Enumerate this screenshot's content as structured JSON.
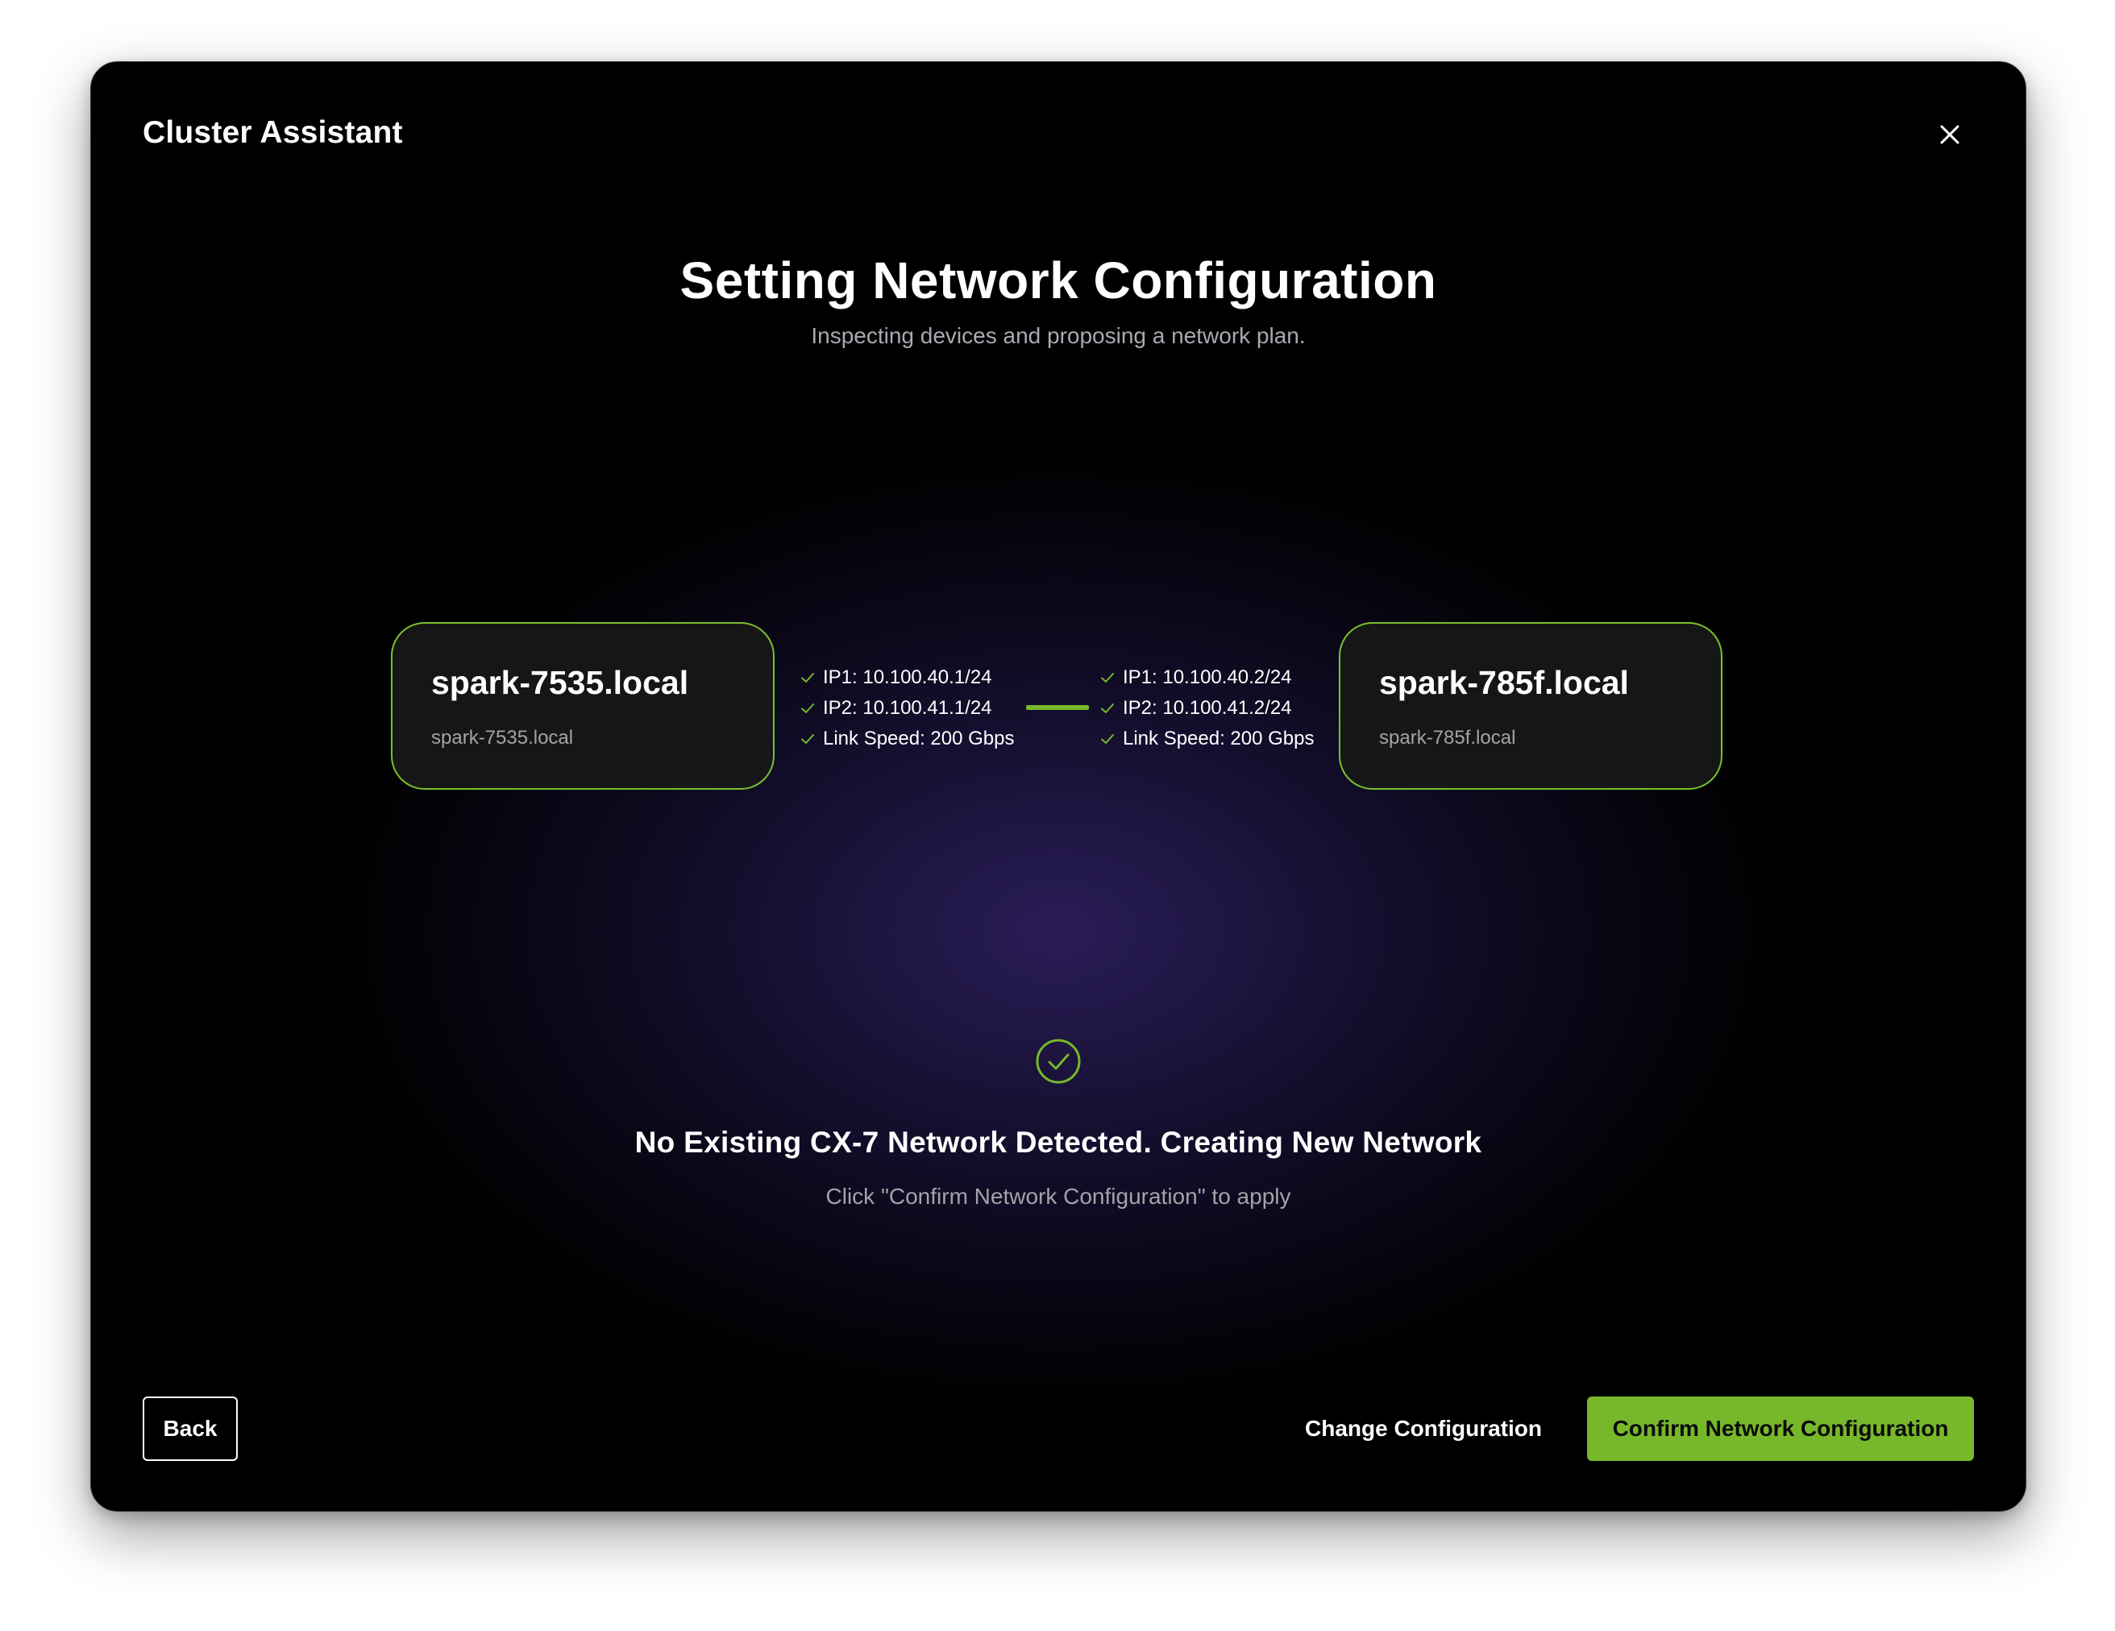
{
  "app": {
    "title": "Cluster Assistant"
  },
  "colors": {
    "accent": "#76b82a",
    "background": "#000000",
    "muted_text": "#a9a9b2"
  },
  "icons": {
    "close": "close-icon",
    "check_small": "check-icon",
    "status": "check-circle-icon"
  },
  "header": {
    "title": "Setting Network Configuration",
    "subtitle": "Inspecting devices and proposing a network plan."
  },
  "nodes": [
    {
      "name": "spark-7535.local",
      "hostname": "spark-7535.local",
      "specs": [
        "IP1: 10.100.40.1/24",
        "IP2: 10.100.41.1/24",
        "Link Speed: 200 Gbps"
      ]
    },
    {
      "name": "spark-785f.local",
      "hostname": "spark-785f.local",
      "specs": [
        "IP1: 10.100.40.2/24",
        "IP2: 10.100.41.2/24",
        "Link Speed: 200 Gbps"
      ]
    }
  ],
  "status": {
    "title": "No Existing CX-7 Network Detected. Creating New Network",
    "message": "Click \"Confirm Network Configuration\" to apply"
  },
  "footer": {
    "back_label": "Back",
    "change_label": "Change Configuration",
    "confirm_label": "Confirm Network Configuration"
  }
}
